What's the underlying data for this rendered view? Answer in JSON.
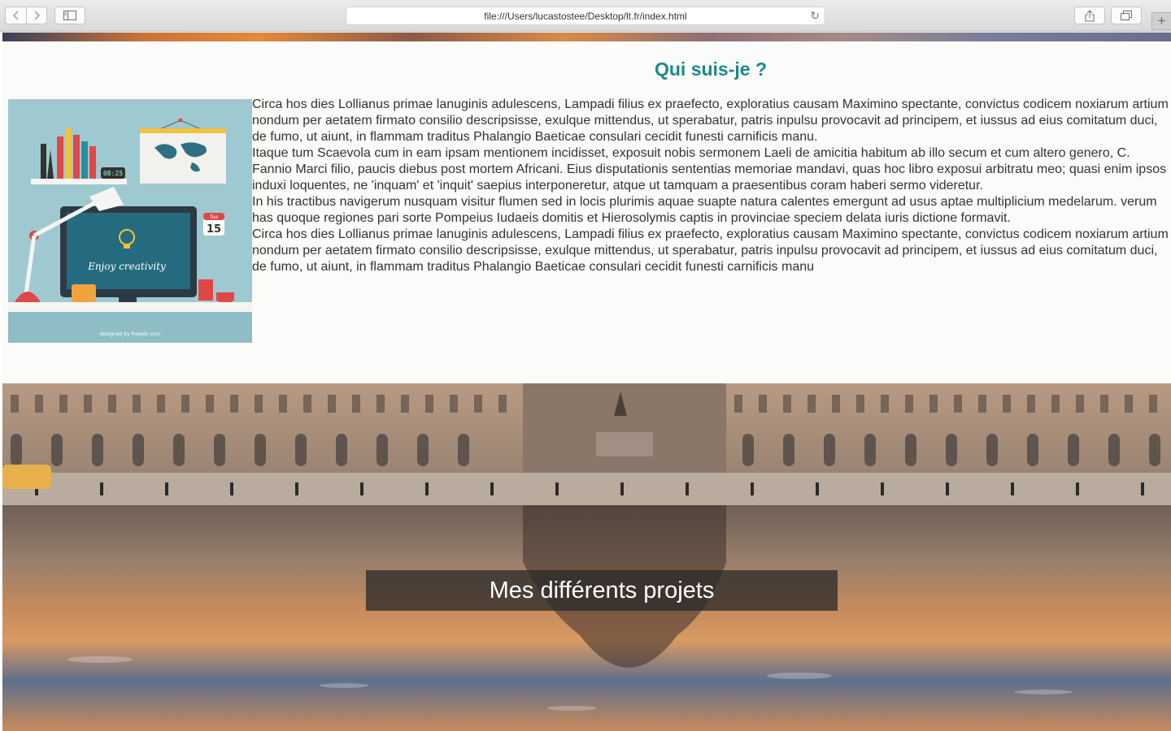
{
  "browser": {
    "url": "file:///Users/lucastostee/Desktop/lt.fr/index.html",
    "back_icon": "chevron-left-icon",
    "forward_icon": "chevron-right-icon",
    "sidebar_icon": "sidebar-icon",
    "reload_icon": "reload-icon",
    "share_icon": "share-icon",
    "tabs_icon": "tabs-icon",
    "new_tab_icon": "plus-icon"
  },
  "about": {
    "title": "Qui suis-je ?",
    "illustration": {
      "caption": "Enjoy creativity",
      "calendar_day": "15",
      "calendar_month": "Tue",
      "clock": "08:25",
      "credit": "designed by freepik.com"
    },
    "paragraphs": [
      "Circa hos dies Lollianus primae lanuginis adulescens, Lampadi filius ex praefecto, exploratius causam Maximino spectante, convictus codicem noxiarum artium nondum per aetatem firmato consilio descripsisse, exulque mittendus, ut sperabatur, patris inpulsu provocavit ad principem, et iussus ad eius comitatum duci, de fumo, ut aiunt, in flammam traditus Phalangio Baeticae consulari cecidit funesti carnificis manu.",
      "Itaque tum Scaevola cum in eam ipsam mentionem incidisset, exposuit nobis sermonem Laeli de amicitia habitum ab illo secum et cum altero genero, C. Fannio Marci filio, paucis diebus post mortem Africani. Eius disputationis sententias memoriae mandavi, quas hoc libro exposui arbitratu meo; quasi enim ipsos induxi loquentes, ne 'inquam' et 'inquit' saepius interponeretur, atque ut tamquam a praesentibus coram haberi sermo videretur.",
      "In his tractibus navigerum nusquam visitur flumen sed in locis plurimis aquae suapte natura calentes emergunt ad usus aptae multiplicium medelarum. verum has quoque regiones pari sorte Pompeius Iudaeis domitis et Hierosolymis captis in provinciae speciem delata iuris dictione formavit.",
      "Circa hos dies Lollianus primae lanuginis adulescens, Lampadi filius ex praefecto, exploratius causam Maximino spectante, convictus codicem noxiarum artium nondum per aetatem firmato consilio descripsisse, exulque mittendus, ut sperabatur, patris inpulsu provocavit ad principem, et iussus ad eius comitatum duci, de fumo, ut aiunt, in flammam traditus Phalangio Baeticae consulari cecidit funesti carnificis manu"
    ]
  },
  "projects": {
    "caption": "Mes différents projets"
  },
  "colors": {
    "title_accent": "#1a8a8a",
    "text": "#333333",
    "about_bg": "#fbfbf9"
  }
}
